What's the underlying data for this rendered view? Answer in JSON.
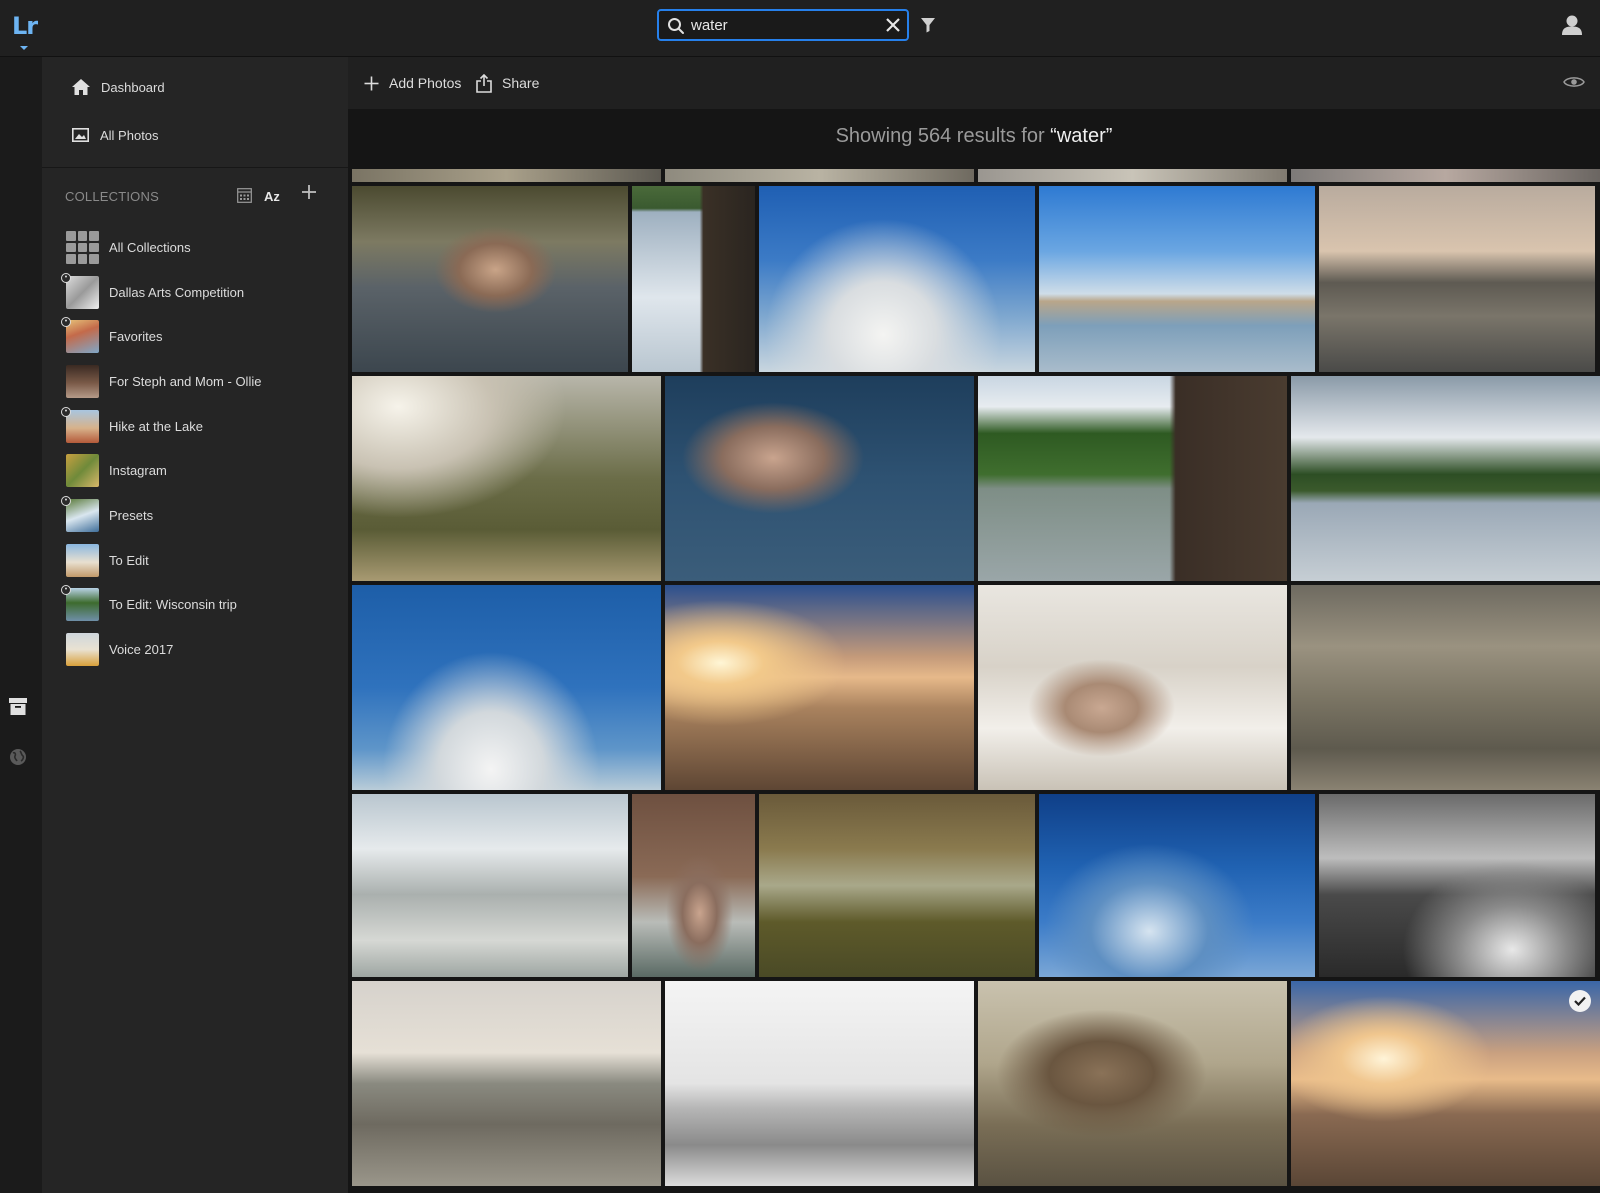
{
  "app": {
    "logo": "Lr",
    "brand_color": "#6db4f2"
  },
  "search": {
    "value": "water",
    "placeholder": "Search",
    "accent": "#2680eb"
  },
  "icons": {
    "search": "search-icon",
    "clear": "close-icon",
    "filter": "filter-icon",
    "user": "user-icon",
    "archive": "archive-icon",
    "globe": "globe-icon",
    "home": "home-icon",
    "photos": "image-icon",
    "add": "plus-icon",
    "share": "share-icon",
    "view": "eye-icon",
    "check": "checkmark-icon"
  },
  "nav": {
    "dashboard": "Dashboard",
    "all_photos": "All Photos"
  },
  "collections": {
    "header": "COLLECTIONS",
    "sort_label": "Az",
    "items": [
      {
        "label": "All Collections",
        "shared": false
      },
      {
        "label": "Dallas Arts Competition",
        "shared": true
      },
      {
        "label": "Favorites",
        "shared": true
      },
      {
        "label": "For Steph and Mom - Ollie",
        "shared": false
      },
      {
        "label": "Hike at the Lake",
        "shared": true
      },
      {
        "label": "Instagram",
        "shared": false
      },
      {
        "label": "Presets",
        "shared": true
      },
      {
        "label": "To Edit",
        "shared": false
      },
      {
        "label": "To Edit: Wisconsin trip",
        "shared": true
      },
      {
        "label": "Voice 2017",
        "shared": false
      }
    ]
  },
  "toolbar": {
    "add_photos": "Add Photos",
    "share": "Share"
  },
  "results": {
    "prefix": "Showing 564 results for ",
    "query": "“water”"
  },
  "photos": {
    "selected_count": 1
  }
}
